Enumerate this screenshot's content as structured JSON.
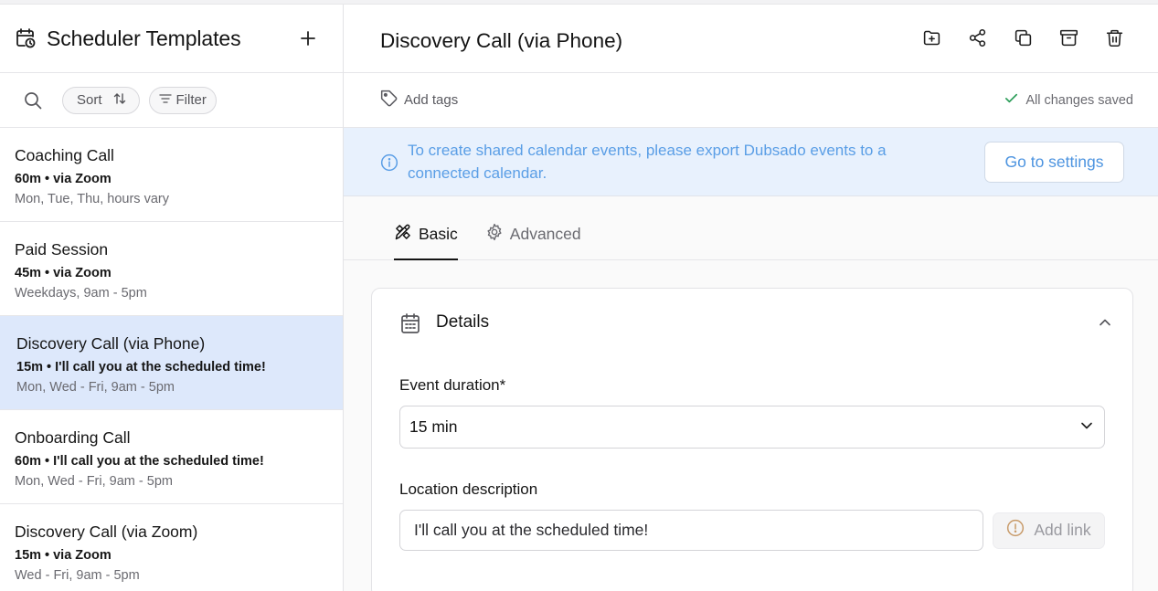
{
  "sidebar": {
    "title": "Scheduler Templates",
    "toolbar": {
      "sort_label": "Sort",
      "filter_label": "Filter"
    },
    "items": [
      {
        "name": "Coaching Call",
        "duration": "60m",
        "location": "via Zoom",
        "hours": "Mon, Tue, Thu, hours vary"
      },
      {
        "name": "Paid Session",
        "duration": "45m",
        "location": "via Zoom",
        "hours": "Weekdays, 9am - 5pm"
      },
      {
        "name": "Discovery Call (via Phone)",
        "duration": "15m",
        "location": "I'll call you at the scheduled time!",
        "hours": "Mon, Wed - Fri, 9am - 5pm",
        "selected": true
      },
      {
        "name": "Onboarding Call",
        "duration": "60m",
        "location": "I'll call you at the scheduled time!",
        "hours": "Mon, Wed - Fri, 9am - 5pm"
      },
      {
        "name": "Discovery Call (via Zoom)",
        "duration": "15m",
        "location": "via Zoom",
        "hours": "Wed - Fri, 9am - 5pm"
      }
    ]
  },
  "main": {
    "title": "Discovery Call (via Phone)",
    "actions": [
      "folder-plus-icon",
      "share-icon",
      "copy-icon",
      "archive-icon",
      "trash-icon"
    ],
    "add_tags_label": "Add tags",
    "saved_status": "All changes saved",
    "banner": {
      "text": "To create shared calendar events, please export Dubsado events to a connected calendar.",
      "button_label": "Go to settings"
    },
    "tabs": [
      {
        "label": "Basic",
        "active": true
      },
      {
        "label": "Advanced",
        "active": false
      }
    ],
    "details": {
      "title": "Details",
      "duration_label": "Event duration*",
      "duration_value": "15 min",
      "location_label": "Location description",
      "location_value": "I'll call you at the scheduled time!",
      "add_link_label": "Add link"
    }
  },
  "colors": {
    "selected_row": "#dde8fb",
    "banner_bg": "#e8f1fd",
    "banner_text": "#5a9ee6",
    "success_check": "#2e9e5b"
  }
}
